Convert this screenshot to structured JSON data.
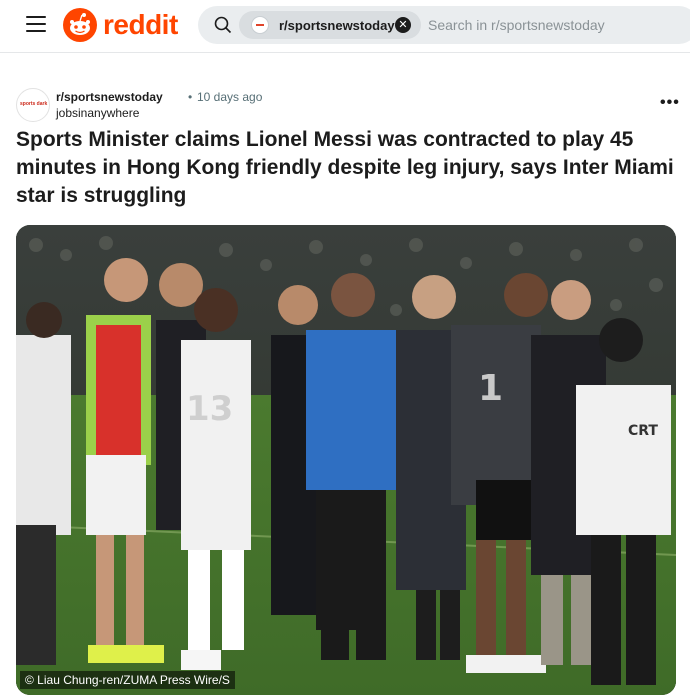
{
  "header": {
    "logo_text": "reddit",
    "search": {
      "community_chip": "r/sportsnewstoday",
      "placeholder": "Search in r/sportsnewstoday"
    }
  },
  "post": {
    "subreddit": "r/sportsnewstoday",
    "separator": "•",
    "age": "10 days ago",
    "author": "jobsinanywhere",
    "subreddit_avatar_text": "sports dark",
    "more_label": "•••",
    "title": "Sports Minister claims Lionel Messi was contracted to play 45 minutes in Hong Kong friendly despite leg injury, says Inter Miami star is struggling",
    "image": {
      "caption": "© Liau Chung-ren/ZUMA Press Wire/S",
      "jersey_numbers": [
        "13",
        "1"
      ],
      "jacket_text": "CRT"
    }
  },
  "colors": {
    "brand": "#ff4500",
    "meta_grey": "#576f76",
    "search_bg": "#eaedef"
  }
}
